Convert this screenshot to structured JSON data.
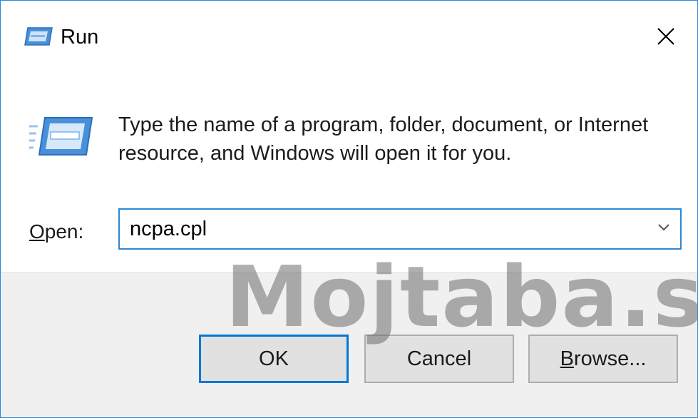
{
  "window": {
    "title": "Run",
    "close_glyph": "✕"
  },
  "content": {
    "description": "Type the name of a program, folder, document, or Internet resource, and Windows will open it for you.",
    "open_label_first": "O",
    "open_label_rest": "pen:",
    "input_value": "ncpa.cpl"
  },
  "buttons": {
    "ok": "OK",
    "cancel": "Cancel",
    "browse_first": "B",
    "browse_rest": "rowse..."
  },
  "watermark": "Mojtaba.safo",
  "icons": {
    "title": "run-icon",
    "big": "run-icon-large",
    "close": "close-icon",
    "dropdown": "chevron-down-icon"
  },
  "colors": {
    "accent": "#0078d7",
    "border": "#2b88d8",
    "footer_bg": "#f0f0f0",
    "button_bg": "#e1e1e1"
  }
}
